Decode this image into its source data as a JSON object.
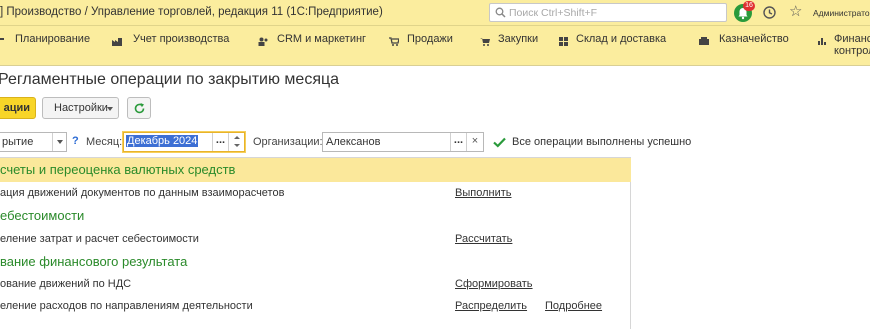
{
  "window": {
    "title": "] Производство / Управление торговлей, редакция 11  (1С:Предприятие)",
    "search_placeholder": "Поиск Ctrl+Shift+F",
    "notifications_count": "16",
    "user": "Администратор"
  },
  "sections": [
    {
      "label": "Планирование",
      "icon": "planning-icon"
    },
    {
      "label": "Учет производства",
      "icon": "production-icon"
    },
    {
      "label": "CRM и маркетинг",
      "icon": "crm-icon"
    },
    {
      "label": "Продажи",
      "icon": "sales-icon"
    },
    {
      "label": "Закупки",
      "icon": "purchases-icon"
    },
    {
      "label": "Склад и доставка",
      "icon": "warehouse-icon"
    },
    {
      "label": "Казначейство",
      "icon": "treasury-icon"
    },
    {
      "label": "Финансовый контроль",
      "label_line1": "Финансо",
      "label_line2": "контроль",
      "icon": "finance-icon"
    }
  ],
  "page": {
    "title": "Регламентные операции по закрытию месяца"
  },
  "toolbar": {
    "primary_label": "ации",
    "settings_label": "Настройки",
    "refresh_icon": "refresh-icon"
  },
  "filters": {
    "period_value": "рытие",
    "help_label": "?",
    "month_label": "Месяц:",
    "month_value": "Декабрь 2024",
    "org_label": "Организации:",
    "org_value": "Алексанов",
    "choose_label": "...",
    "clear_label": "×",
    "status_text": "Все операции выполнены успешно",
    "status_color": "#2a9a3b"
  },
  "operations": {
    "groups": [
      {
        "title": "счеты и переоценка валютных средств",
        "active": true,
        "items": [
          {
            "name": "ация движений документов по данным взаиморасчетов",
            "actions": [
              "Выполнить"
            ]
          }
        ]
      },
      {
        "title": "ебестоимости",
        "active": false,
        "items": [
          {
            "name": "еление затрат и расчет себестоимости",
            "actions": [
              "Рассчитать"
            ]
          }
        ]
      },
      {
        "title": "вание финансового результата",
        "active": false,
        "items": [
          {
            "name": "ование движений по НДС",
            "actions": [
              "Сформировать"
            ]
          },
          {
            "name": "еление расходов по направлениям деятельности",
            "actions": [
              "Распределить",
              "Подробнее"
            ]
          }
        ]
      }
    ]
  },
  "colors": {
    "header_bg": "#fbed9e",
    "group_title": "#2a8a2a",
    "active_row": "#fbe89b",
    "primary_button": "#f8d528"
  }
}
